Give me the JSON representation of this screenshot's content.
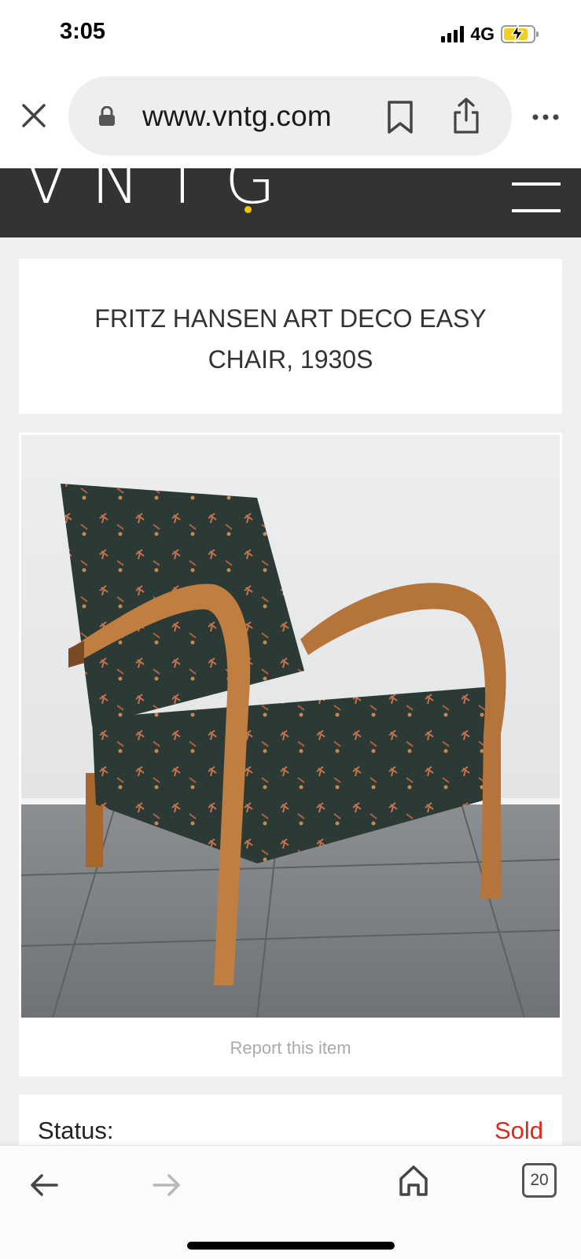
{
  "status_bar": {
    "time": "3:05",
    "network": "4G"
  },
  "browser": {
    "url": "www.vntg.com",
    "tab_count": "20",
    "icons": [
      "close-icon",
      "lock-icon",
      "bookmark-icon",
      "share-icon",
      "more-icon",
      "back-icon",
      "forward-icon",
      "home-icon",
      "tabs-icon"
    ]
  },
  "site": {
    "logo": "VNTG",
    "accent": "#f5c400",
    "header_bg": "#333333"
  },
  "product": {
    "title": "Fritz Hansen Art Deco Easy Chair, 1930s",
    "report_label": "Report this item",
    "status_label": "Status:",
    "status_value": "Sold",
    "status_color": "#e3261b"
  }
}
